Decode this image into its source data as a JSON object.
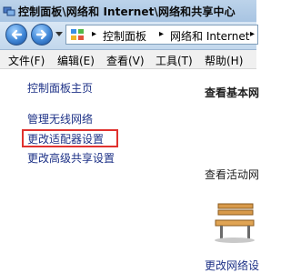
{
  "window": {
    "title": "控制面板\\网络和 Internet\\网络和共享中心"
  },
  "navigation": {
    "back_icon": "back-arrow-icon",
    "forward_icon": "forward-arrow-icon",
    "address": {
      "icon": "control-panel-icon",
      "crumbs": [
        "控制面板",
        "网络和 Internet"
      ]
    }
  },
  "menu": {
    "items": [
      "文件(F)",
      "编辑(E)",
      "查看(V)",
      "工具(T)",
      "帮助(H)"
    ]
  },
  "sidebar": {
    "items": [
      "控制面板主页",
      "管理无线网络",
      "更改适配器设置",
      "更改高级共享设置"
    ],
    "highlighted_item": "更改适配器设置",
    "highlight_color": "#e0312e"
  },
  "main": {
    "heading": "查看基本网",
    "subheading": "查看活动网",
    "bottom_link": "更改网络设"
  }
}
